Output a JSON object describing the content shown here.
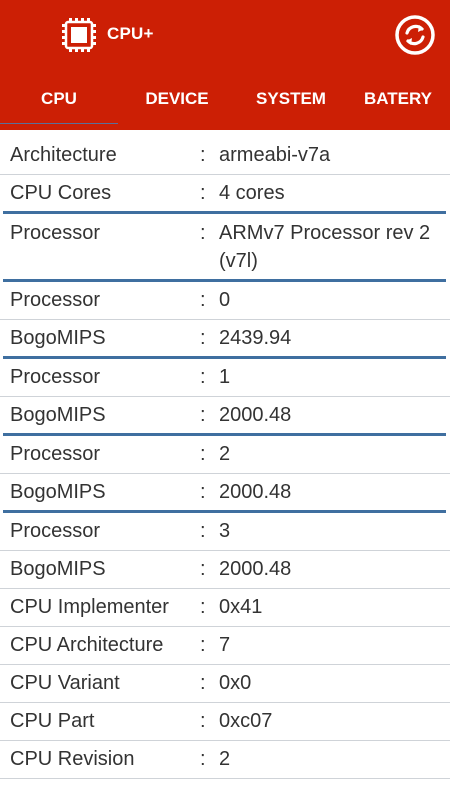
{
  "app": {
    "title": "CPU+",
    "logo_icon": "chip-icon",
    "refresh_icon": "refresh-icon"
  },
  "colors": {
    "appbar": "#cc1f05",
    "tab_indicator": "#5b6f9a",
    "group_divider": "#3f6fa0"
  },
  "tabs": [
    {
      "label": "CPU",
      "selected": true
    },
    {
      "label": "DEVICE",
      "selected": false
    },
    {
      "label": "SYSTEM",
      "selected": false
    },
    {
      "label": "BATERY",
      "selected": false
    }
  ],
  "rows": [
    {
      "key": "Architecture",
      "sep": ":",
      "value": "armeabi-v7a"
    },
    {
      "key": "CPU Cores",
      "sep": ":",
      "value": "4 cores"
    },
    {
      "key": "Processor",
      "sep": ":",
      "value": "ARMv7 Processor rev 2 (v7l)"
    },
    {
      "key": "Processor",
      "sep": ":",
      "value": "0"
    },
    {
      "key": "BogoMIPS",
      "sep": ":",
      "value": "2439.94"
    },
    {
      "key": "Processor",
      "sep": ":",
      "value": "1"
    },
    {
      "key": "BogoMIPS",
      "sep": ":",
      "value": "2000.48"
    },
    {
      "key": "Processor",
      "sep": ":",
      "value": "2"
    },
    {
      "key": "BogoMIPS",
      "sep": ":",
      "value": "2000.48"
    },
    {
      "key": "Processor",
      "sep": ":",
      "value": "3"
    },
    {
      "key": "BogoMIPS",
      "sep": ":",
      "value": "2000.48"
    },
    {
      "key": "CPU Implementer",
      "sep": ":",
      "value": "0x41"
    },
    {
      "key": "CPU Architecture",
      "sep": ":",
      "value": "7"
    },
    {
      "key": "CPU Variant",
      "sep": ":",
      "value": "0x0"
    },
    {
      "key": "CPU Part",
      "sep": ":",
      "value": "0xc07"
    },
    {
      "key": "CPU Revision",
      "sep": ":",
      "value": "2"
    }
  ]
}
